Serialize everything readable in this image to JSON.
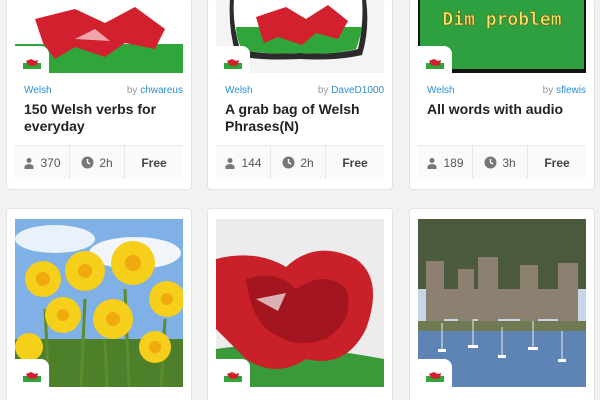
{
  "cards": [
    {
      "language": "Welsh",
      "by_prefix": "by",
      "author": "chwareus",
      "title": "150 Welsh verbs for everyday",
      "learners": "370",
      "time": "2h",
      "price": "Free"
    },
    {
      "language": "Welsh",
      "by_prefix": "by",
      "author": "DaveD1000",
      "title": "A grab bag of Welsh Phrases(N)",
      "learners": "144",
      "time": "2h",
      "price": "Free"
    },
    {
      "language": "Welsh",
      "by_prefix": "by",
      "author": "sflewis",
      "title": "All words with audio",
      "learners": "189",
      "time": "3h",
      "price": "Free",
      "image_text": "Dim problem"
    }
  ],
  "row2": [
    {
      "language": "Welsh",
      "image": "daffodils"
    },
    {
      "language": "Welsh",
      "image": "welsh-dragon-flag"
    },
    {
      "language": "Welsh",
      "image": "castle-harbour"
    }
  ],
  "icons": {
    "learners": "person-icon",
    "time": "clock-icon",
    "flag": "welsh-flag-icon"
  },
  "colors": {
    "link": "#2a8ed6",
    "flag_green": "#2fa53a",
    "flag_red": "#d3202e"
  }
}
